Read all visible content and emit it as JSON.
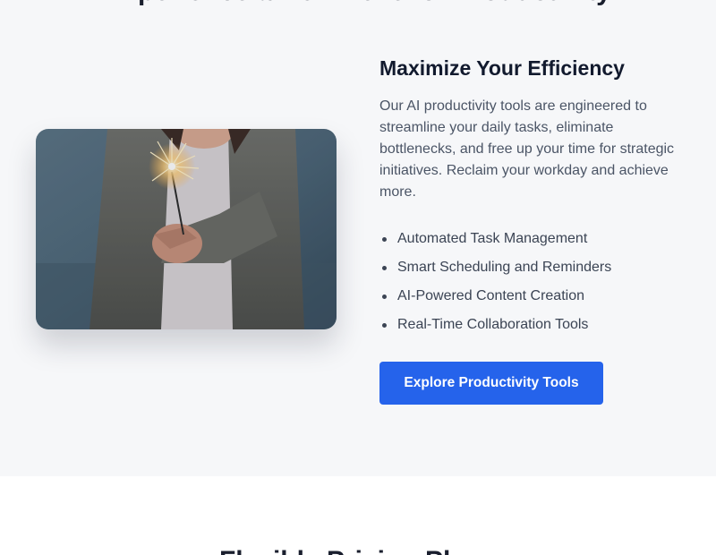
{
  "feature_section": {
    "heading": "Experience a New Level of Productivity",
    "title": "Maximize Your Efficiency",
    "description": "Our AI productivity tools are engineered to streamline your daily tasks, eliminate bottlenecks, and free up your time for strategic initiatives. Reclaim your workday and achieve more.",
    "features": [
      "Automated Task Management",
      "Smart Scheduling and Reminders",
      "AI-Powered Content Creation",
      "Real-Time Collaboration Tools"
    ],
    "cta_label": "Explore Productivity Tools"
  },
  "pricing_section": {
    "heading": "Flexible Pricing Plans"
  },
  "colors": {
    "section_bg": "#f6f7f9",
    "accent": "#2563eb",
    "heading_text": "#121a2e",
    "body_text": "#4b5566"
  },
  "image": {
    "subject": "person holding a lit sparkler"
  }
}
